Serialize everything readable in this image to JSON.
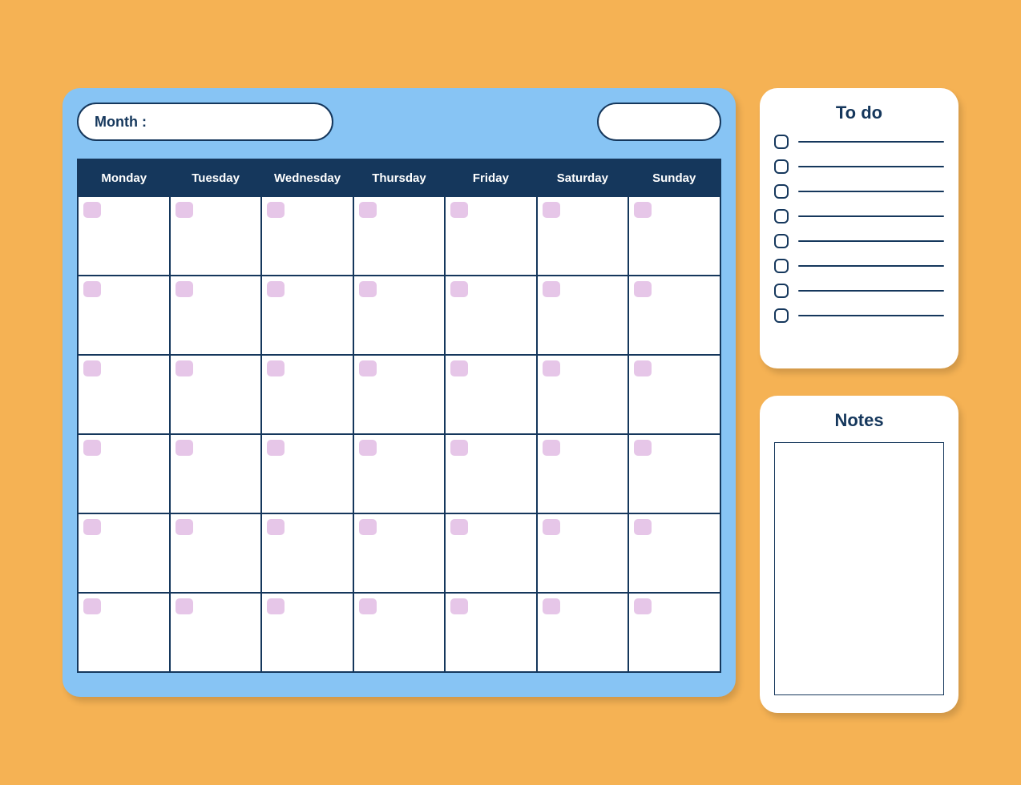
{
  "calendar": {
    "month_label": "Month :",
    "weekdays": [
      "Monday",
      "Tuesday",
      "Wednesday",
      "Thursday",
      "Friday",
      "Saturday",
      "Sunday"
    ],
    "rows": 6
  },
  "sidebar": {
    "todo": {
      "title": "To do",
      "item_count": 8
    },
    "notes": {
      "title": "Notes"
    }
  }
}
